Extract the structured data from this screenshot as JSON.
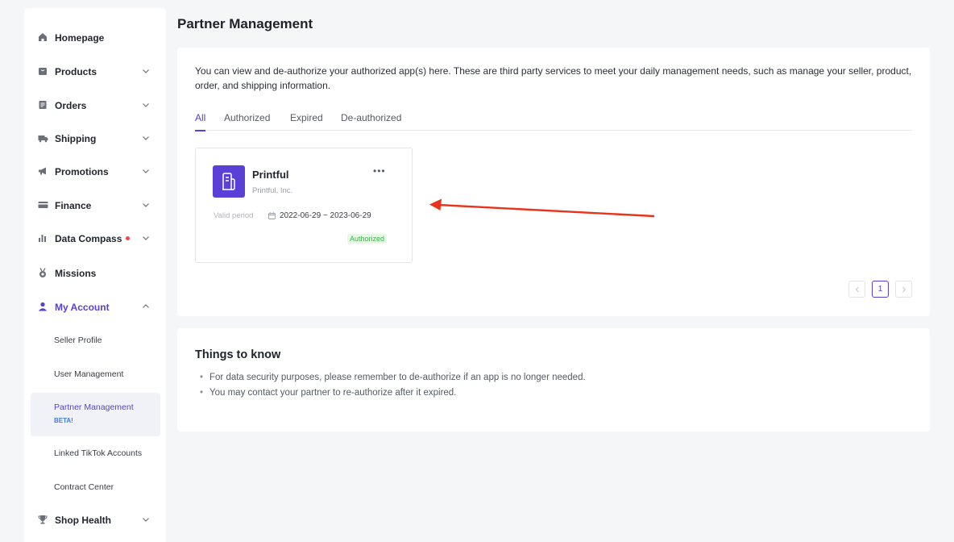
{
  "sidebar": {
    "items": [
      {
        "label": "Homepage",
        "icon": "home-icon"
      },
      {
        "label": "Products",
        "icon": "bag-icon"
      },
      {
        "label": "Orders",
        "icon": "document-icon"
      },
      {
        "label": "Shipping",
        "icon": "truck-icon"
      },
      {
        "label": "Promotions",
        "icon": "megaphone-icon"
      },
      {
        "label": "Finance",
        "icon": "card-icon"
      },
      {
        "label": "Data Compass",
        "icon": "bar-chart-icon"
      },
      {
        "label": "Missions",
        "icon": "medal-icon"
      },
      {
        "label": "My Account",
        "icon": "user-icon"
      },
      {
        "label": "Shop Health",
        "icon": "trophy-icon"
      }
    ],
    "my_account_sub": [
      {
        "label": "Seller Profile"
      },
      {
        "label": "User Management"
      },
      {
        "label": "Partner Management",
        "badge": "BETA!"
      },
      {
        "label": "Linked TikTok Accounts"
      },
      {
        "label": "Contract Center"
      }
    ]
  },
  "page": {
    "title": "Partner Management",
    "description": "You can view and de-authorize your authorized app(s) here. These are third party services to meet your daily management needs, such as manage your seller, product, order, and shipping information.",
    "tabs": [
      "All",
      "Authorized",
      "Expired",
      "De-authorized"
    ],
    "active_tab": "All"
  },
  "app_card": {
    "name": "Printful",
    "company": "Printful, Inc.",
    "more_label": "•••",
    "valid_label": "Valid period",
    "valid_dates": "2022-06-29 ~ 2023-06-29",
    "status": "Authorized"
  },
  "pagination": {
    "current": "1"
  },
  "things_to_know": {
    "title": "Things to know",
    "bullet_char": "•",
    "items": [
      "For data security purposes, please remember to de-authorize if an app is no longer needed.",
      "You may contact your partner to re-authorize after it expired."
    ]
  },
  "colors": {
    "accent": "#5a3fd6",
    "logo_bg": "#5b40d8",
    "status_green": "#3fb34f",
    "arrow_red": "#e8341c",
    "notification_dot": "#f5424c"
  }
}
